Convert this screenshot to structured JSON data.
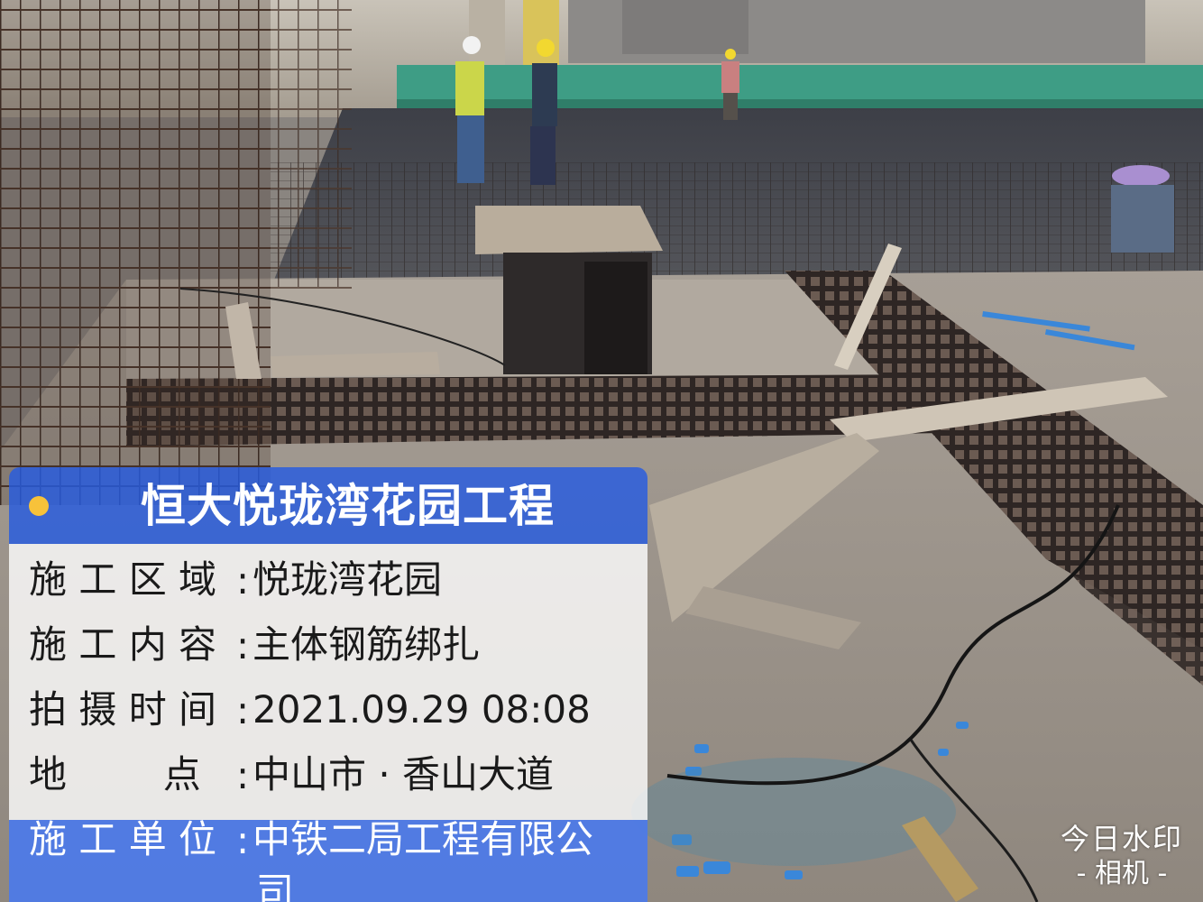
{
  "watermark": {
    "project_title": "恒大悦珑湾花园工程",
    "rows": [
      {
        "label": "施 工 区 域",
        "value": "悦珑湾花园"
      },
      {
        "label": "施 工 内 容",
        "value": "主体钢筋绑扎"
      },
      {
        "label": "拍 摄 时 间",
        "value": "2021.09.29 08:08"
      },
      {
        "label": "地        点",
        "value": "中山市 · 香山大道"
      },
      {
        "label": "施 工 单 位",
        "value": "中铁二局工程有限公",
        "value_wrap": "司"
      }
    ],
    "colon": ":",
    "colors": {
      "header": "#265ce0",
      "dot": "#f7c23a"
    }
  },
  "logo": {
    "line1": "今日水印",
    "line2": "- 相机 -"
  }
}
